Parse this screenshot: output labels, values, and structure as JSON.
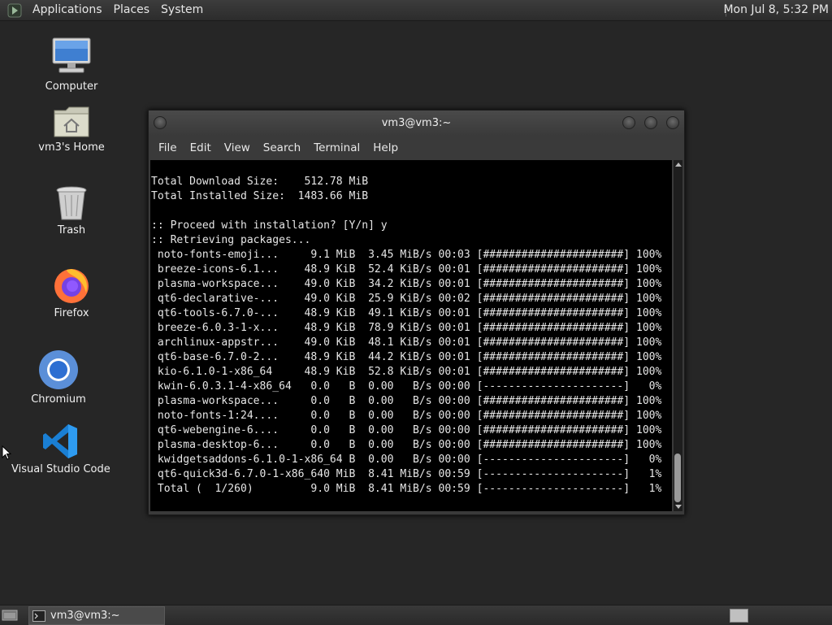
{
  "top_panel": {
    "menus": [
      "Applications",
      "Places",
      "System"
    ],
    "clock": "Mon Jul  8,  5:32 PM"
  },
  "desktop_icons": [
    {
      "label": "Computer",
      "icon": "computer-icon"
    },
    {
      "label": "vm3's Home",
      "icon": "home-folder-icon"
    },
    {
      "label": "Trash",
      "icon": "trash-icon"
    },
    {
      "label": "Firefox",
      "icon": "firefox-icon"
    },
    {
      "label": "Chromium",
      "icon": "chromium-icon"
    },
    {
      "label": "Visual Studio Code",
      "icon": "vscode-icon"
    }
  ],
  "terminal": {
    "title": "vm3@vm3:~",
    "menus": [
      "File",
      "Edit",
      "View",
      "Search",
      "Terminal",
      "Help"
    ],
    "lines": [
      "Total Download Size:    512.78 MiB",
      "Total Installed Size:  1483.66 MiB",
      "",
      ":: Proceed with installation? [Y/n] y",
      ":: Retrieving packages...",
      " noto-fonts-emoji...     9.1 MiB  3.45 MiB/s 00:03 [######################] 100%",
      " breeze-icons-6.1...    48.9 KiB  52.4 KiB/s 00:01 [######################] 100%",
      " plasma-workspace...    49.0 KiB  34.2 KiB/s 00:01 [######################] 100%",
      " qt6-declarative-...    49.0 KiB  25.9 KiB/s 00:02 [######################] 100%",
      " qt6-tools-6.7.0-...    48.9 KiB  49.1 KiB/s 00:01 [######################] 100%",
      " breeze-6.0.3-1-x...    48.9 KiB  78.9 KiB/s 00:01 [######################] 100%",
      " archlinux-appstr...    49.0 KiB  48.1 KiB/s 00:01 [######################] 100%",
      " qt6-base-6.7.0-2...    48.9 KiB  44.2 KiB/s 00:01 [######################] 100%",
      " kio-6.1.0-1-x86_64     48.9 KiB  52.8 KiB/s 00:01 [######################] 100%",
      " kwin-6.0.3.1-4-x86_64   0.0   B  0.00   B/s 00:00 [----------------------]   0%",
      " plasma-workspace...     0.0   B  0.00   B/s 00:00 [######################] 100%",
      " noto-fonts-1:24....     0.0   B  0.00   B/s 00:00 [######################] 100%",
      " qt6-webengine-6....     0.0   B  0.00   B/s 00:00 [######################] 100%",
      " plasma-desktop-6...     0.0   B  0.00   B/s 00:00 [######################] 100%",
      " kwidgetsaddons-6.1.0-1-x86_64 B  0.00   B/s 00:00 [----------------------]   0%",
      " qt6-quick3d-6.7.0-1-x86_640 MiB  8.41 MiB/s 00:59 [----------------------]   1%",
      " Total (  1/260)         9.0 MiB  8.41 MiB/s 00:59 [----------------------]   1%"
    ]
  },
  "taskbar": {
    "window_label": "vm3@vm3:~"
  }
}
